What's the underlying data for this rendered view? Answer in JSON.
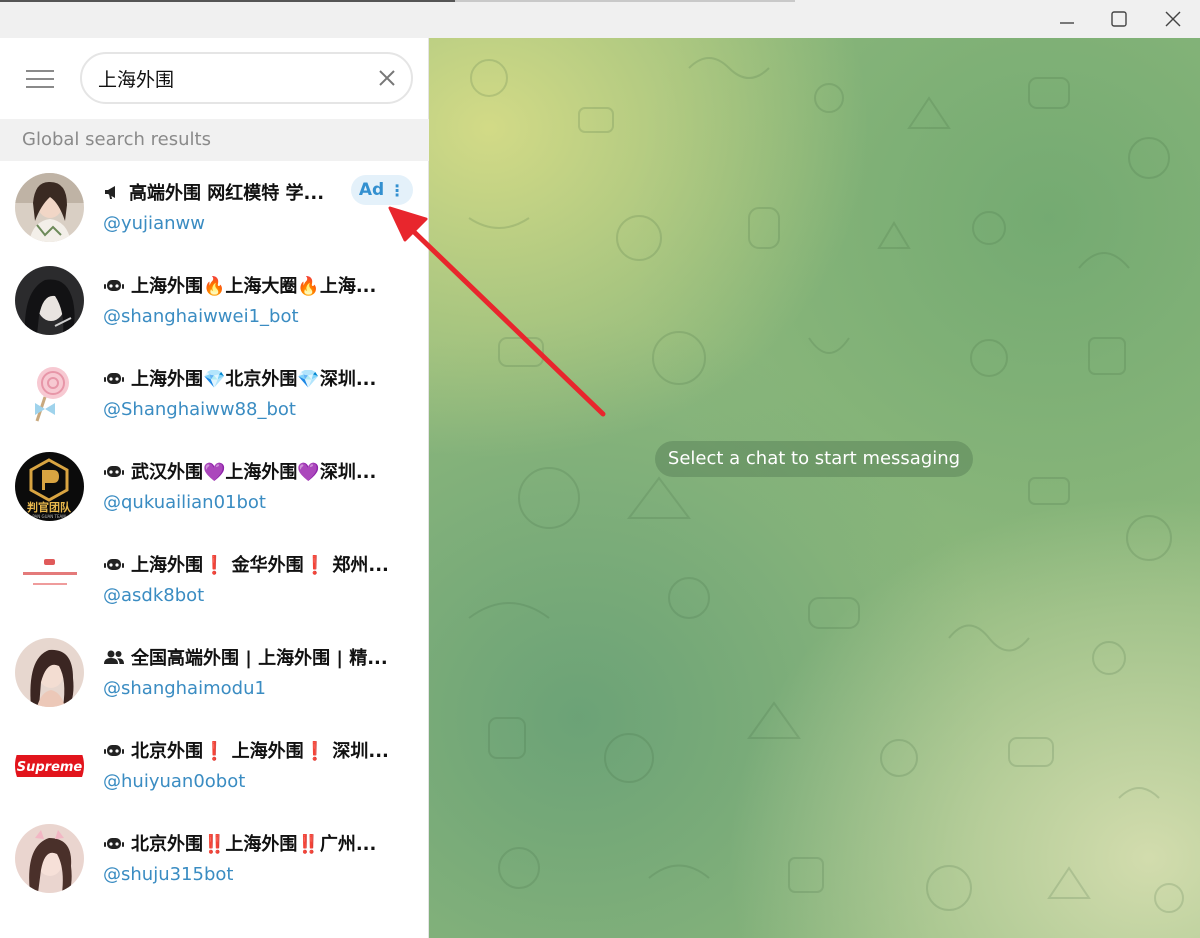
{
  "search": {
    "value": "上海外围"
  },
  "section_header": "Global search results",
  "results": [
    {
      "title": "高端外围 网红模特 学...",
      "handle": "@yujianww",
      "kind": "megaphone-icon",
      "ad": true
    },
    {
      "title": "上海外围🔥上海大圈🔥上海...",
      "handle": "@shanghaiwwei1_bot",
      "kind": "bot-icon",
      "ad": false
    },
    {
      "title": "上海外围💎北京外围💎深圳...",
      "handle": "@Shanghaiww88_bot",
      "kind": "bot-icon",
      "ad": false
    },
    {
      "title": "武汉外围💜上海外围💜深圳...",
      "handle": "@qukuailian01bot",
      "kind": "bot-icon",
      "ad": false
    },
    {
      "title": "上海外围❗ 金华外围❗ 郑州...",
      "handle": "@asdk8bot",
      "kind": "bot-icon",
      "ad": false
    },
    {
      "title": "全国高端外围 | 上海外围 | 精...",
      "handle": "@shanghaimodu1",
      "kind": "group-icon",
      "ad": false
    },
    {
      "title": "北京外围❗ 上海外围❗ 深圳...",
      "handle": "@huiyuan0obot",
      "kind": "bot-icon",
      "ad": false
    },
    {
      "title": "北京外围‼️上海外围‼️广州...",
      "handle": "@shuju315bot",
      "kind": "bot-icon",
      "ad": false
    }
  ],
  "ad_badge": {
    "label": "Ad",
    "menu": "⋮"
  },
  "avatars": {
    "a4_text": "判官团队",
    "a4_sub": "PAN GUAN TEAM",
    "a7_text": "Supreme"
  },
  "chat": {
    "empty_message": "Select a chat to start messaging"
  },
  "colors": {
    "link": "#3a8cc2",
    "ad_bg": "#e4f1fa",
    "annotation_arrow": "#e8262d"
  }
}
